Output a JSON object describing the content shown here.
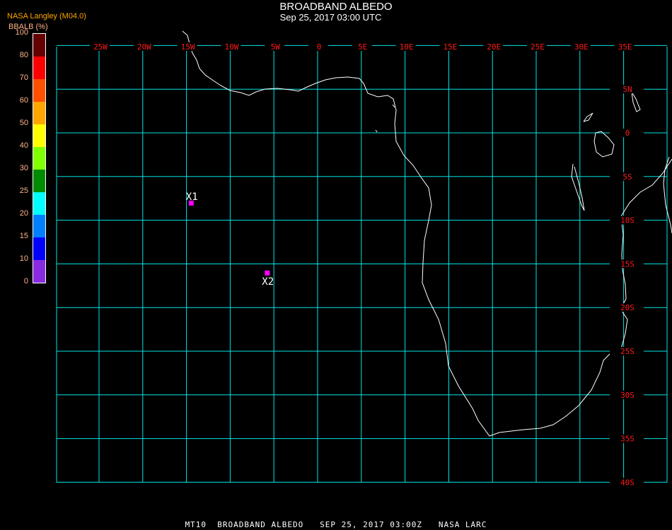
{
  "header": {
    "title": "BROADBAND ALBEDO",
    "subtitle": "Sep 25, 2017 03:00 UTC",
    "source": "NASA Langley (M04.0)"
  },
  "colorbar": {
    "label": "BBALB (%)",
    "ticks": [
      "0",
      "10",
      "15",
      "20",
      "25",
      "30",
      "40",
      "50",
      "60",
      "70",
      "80",
      "100"
    ],
    "colors": [
      "#8a2be2",
      "#0000ff",
      "#0080ff",
      "#00ffff",
      "#008c00",
      "#80ff00",
      "#ffff00",
      "#ffa500",
      "#ff5000",
      "#ff0000",
      "#640000"
    ]
  },
  "map": {
    "longitude_labels": [
      "25W",
      "20W",
      "15W",
      "10W",
      "5W",
      "0",
      "5E",
      "10E",
      "15E",
      "20E",
      "25E",
      "30E",
      "35E"
    ],
    "latitude_labels": [
      "5N",
      "0",
      "5S",
      "10S",
      "15S",
      "20S",
      "25S",
      "30S",
      "35S",
      "40S"
    ],
    "grid_color": "#00e5e5",
    "coast_color": "#ffffff",
    "label_color": "#ff1a1a",
    "marker_color": "#ff00ff",
    "markers": [
      {
        "label": "X1",
        "lon": -14.5,
        "lat": -8.0
      },
      {
        "label": "X2",
        "lon": -5.8,
        "lat": -16.0
      }
    ]
  },
  "footer": "MT10  BROADBAND ALBEDO   SEP 25, 2017 03:00Z   NASA LARC"
}
